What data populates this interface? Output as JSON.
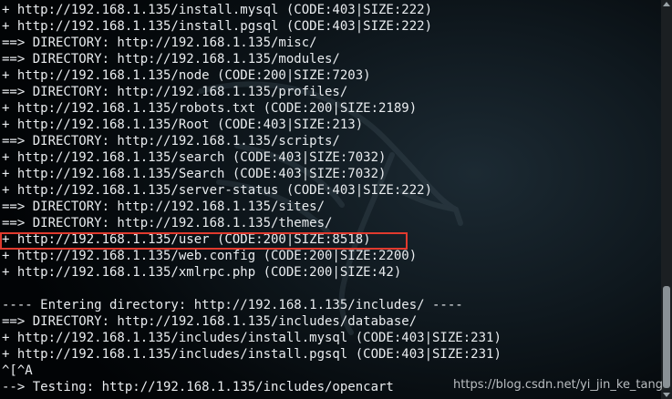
{
  "terminal": {
    "lines": [
      "+ http://192.168.1.135/install.mysql (CODE:403|SIZE:222)",
      "+ http://192.168.1.135/install.pgsql (CODE:403|SIZE:222)",
      "==> DIRECTORY: http://192.168.1.135/misc/",
      "==> DIRECTORY: http://192.168.1.135/modules/",
      "+ http://192.168.1.135/node (CODE:200|SIZE:7203)",
      "==> DIRECTORY: http://192.168.1.135/profiles/",
      "+ http://192.168.1.135/robots.txt (CODE:200|SIZE:2189)",
      "+ http://192.168.1.135/Root (CODE:403|SIZE:213)",
      "==> DIRECTORY: http://192.168.1.135/scripts/",
      "+ http://192.168.1.135/search (CODE:403|SIZE:7032)",
      "+ http://192.168.1.135/Search (CODE:403|SIZE:7032)",
      "+ http://192.168.1.135/server-status (CODE:403|SIZE:222)",
      "==> DIRECTORY: http://192.168.1.135/sites/",
      "==> DIRECTORY: http://192.168.1.135/themes/",
      "+ http://192.168.1.135/user (CODE:200|SIZE:8518)",
      "+ http://192.168.1.135/web.config (CODE:200|SIZE:2200)",
      "+ http://192.168.1.135/xmlrpc.php (CODE:200|SIZE:42)",
      "",
      "---- Entering directory: http://192.168.1.135/includes/ ----",
      "==> DIRECTORY: http://192.168.1.135/includes/database/",
      "+ http://192.168.1.135/includes/install.mysql (CODE:403|SIZE:231)",
      "+ http://192.168.1.135/includes/install.pgsql (CODE:403|SIZE:231)",
      "^[^A",
      "--> Testing: http://192.168.1.135/includes/opencart"
    ],
    "highlighted_line_index": 14,
    "highlight_color": "#e03a2e",
    "text_color": "#e9ecef"
  },
  "watermark": {
    "text": "https://blog.csdn.net/yi_jin_ke_tang"
  }
}
